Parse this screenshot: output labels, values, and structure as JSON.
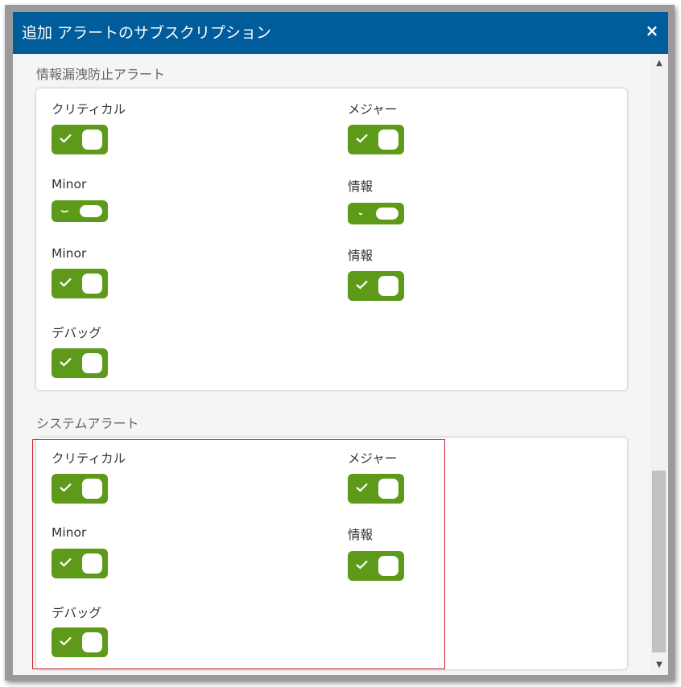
{
  "dialog": {
    "title": "追加 アラートのサブスクリプション",
    "close_symbol": "×"
  },
  "sections": [
    {
      "title": "情報漏洩防止アラート",
      "items": [
        {
          "label": "クリティカル",
          "checked": true
        },
        {
          "label": "メジャー",
          "checked": true
        },
        {
          "label": "Minor",
          "checked": true
        },
        {
          "label": "情報",
          "checked": true
        },
        {
          "label": "Minor",
          "checked": true
        },
        {
          "label": "情報",
          "checked": true
        },
        {
          "label": "デバッグ",
          "checked": true
        }
      ]
    },
    {
      "title": "システムアラート",
      "items": [
        {
          "label": "クリティカル",
          "checked": true
        },
        {
          "label": "メジャー",
          "checked": true
        },
        {
          "label": "Minor",
          "checked": true
        },
        {
          "label": "情報",
          "checked": true
        },
        {
          "label": "デバッグ",
          "checked": true
        }
      ]
    }
  ],
  "colors": {
    "titlebar": "#005c9b",
    "toggle_on": "#5e9a1a",
    "highlight": "#c8232c"
  },
  "icons": {
    "close": "close-icon",
    "check": "check-icon",
    "scroll_up": "chevron-up-icon",
    "scroll_down": "chevron-down-icon"
  },
  "scrollbar": {
    "up_symbol": "▲",
    "down_symbol": "▼"
  }
}
